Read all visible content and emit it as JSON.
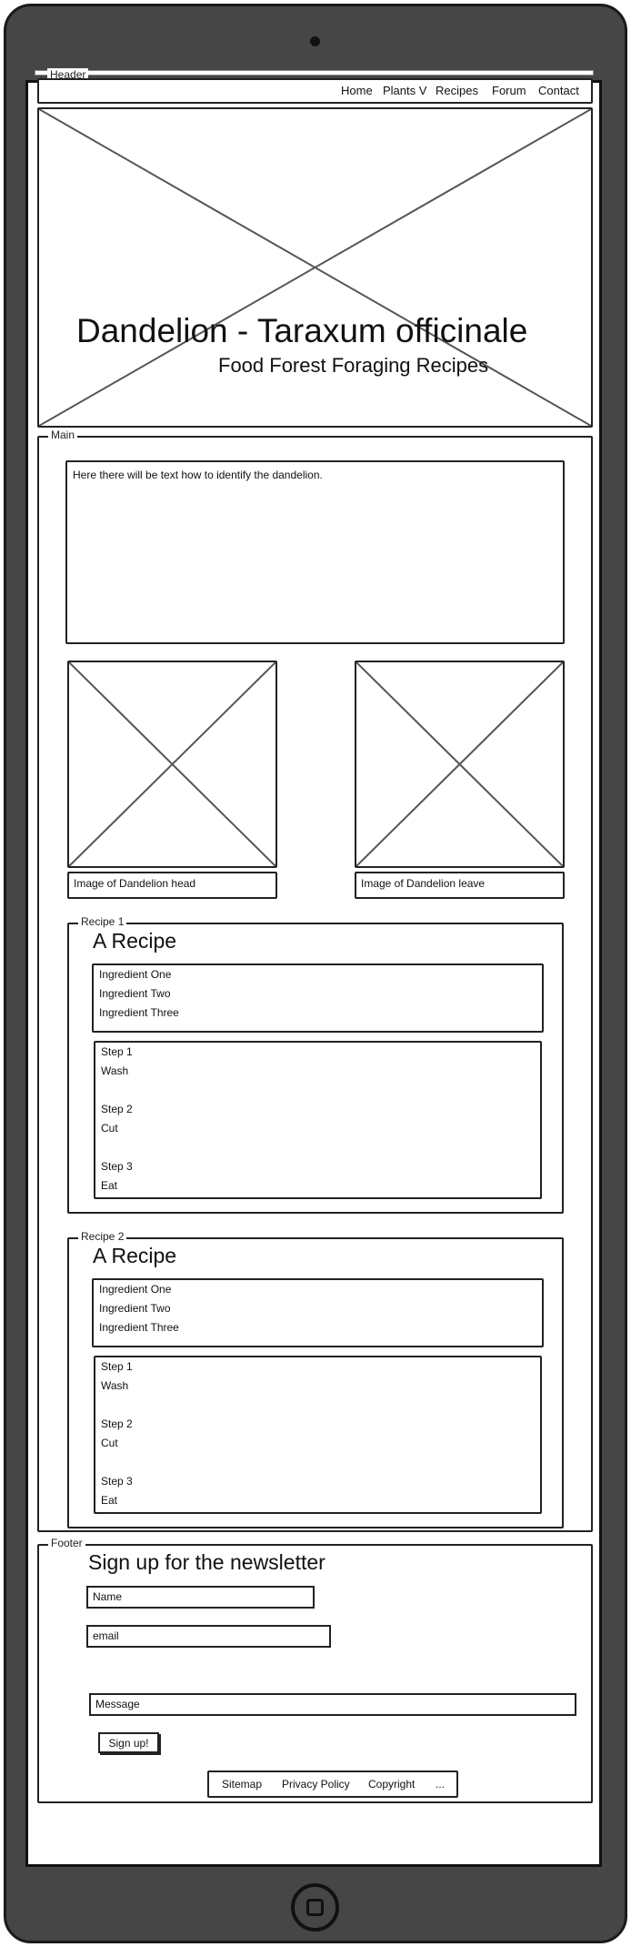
{
  "header": {
    "legend": "Header",
    "nav": [
      {
        "label": "Home"
      },
      {
        "label": "Plants V"
      },
      {
        "label": "Recipes"
      },
      {
        "label": "Forum"
      },
      {
        "label": "Contact"
      }
    ],
    "hero": {
      "title": "Dandelion - Taraxum officinale",
      "subtitle": "Food Forest Foraging Recipes"
    }
  },
  "main": {
    "legend": "Main",
    "intro_text": "Here there will be text how to identify the dandelion.",
    "images": [
      {
        "caption": "Image of Dandelion head"
      },
      {
        "caption": "Image of Dandelion leave"
      }
    ],
    "recipes": [
      {
        "legend": "Recipe 1",
        "title": "A Recipe",
        "ingredients": "Ingredient One\nIngredient Two\nIngredient Three",
        "steps": "Step 1\nWash\n\nStep 2\nCut\n\nStep 3\nEat"
      },
      {
        "legend": "Recipe 2",
        "title": "A Recipe",
        "ingredients": "Ingredient One\nIngredient Two\nIngredient Three",
        "steps": "Step 1\nWash\n\nStep 2\nCut\n\nStep 3\nEat"
      }
    ]
  },
  "footer": {
    "legend": "Footer",
    "newsletter_title": "Sign up for the newsletter",
    "name_field": "Name",
    "email_field": "email",
    "message_field": "Message",
    "signup_button": "Sign up!",
    "links": [
      {
        "label": "Sitemap"
      },
      {
        "label": "Privacy Policy"
      },
      {
        "label": "Copyright"
      },
      {
        "label": "..."
      }
    ]
  }
}
